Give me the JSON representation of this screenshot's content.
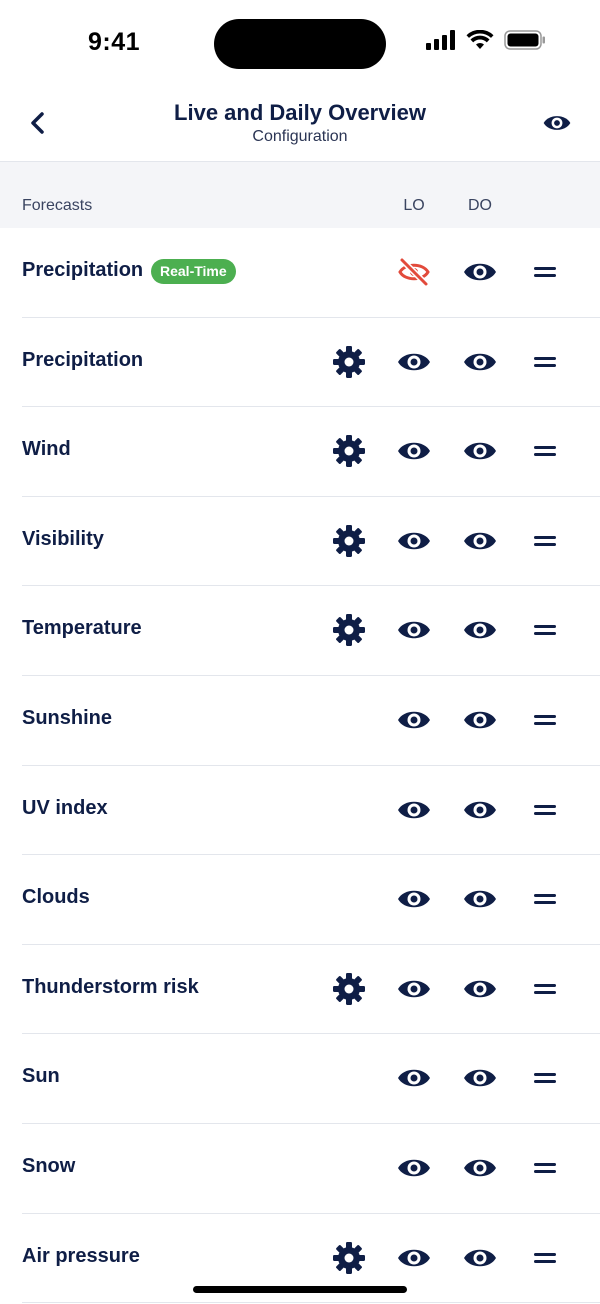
{
  "status_bar": {
    "time": "9:41"
  },
  "header": {
    "title": "Live and Daily Overview",
    "subtitle": "Configuration"
  },
  "table": {
    "section_label": "Forecasts",
    "col_lo": "LO",
    "col_do": "DO"
  },
  "colors": {
    "primary": "#0f1e46",
    "hidden": "#e24a3b",
    "badge": "#4caf50",
    "section_bg": "#f4f5f8"
  },
  "rows": [
    {
      "label": "Precipitation",
      "badge": "Real-Time",
      "settings": false,
      "lo_visible": false,
      "do_visible": true
    },
    {
      "label": "Precipitation",
      "settings": true,
      "lo_visible": true,
      "do_visible": true
    },
    {
      "label": "Wind",
      "settings": true,
      "lo_visible": true,
      "do_visible": true
    },
    {
      "label": "Visibility",
      "settings": true,
      "lo_visible": true,
      "do_visible": true
    },
    {
      "label": "Temperature",
      "settings": true,
      "lo_visible": true,
      "do_visible": true
    },
    {
      "label": "Sunshine",
      "settings": false,
      "lo_visible": true,
      "do_visible": true
    },
    {
      "label": "UV index",
      "settings": false,
      "lo_visible": true,
      "do_visible": true
    },
    {
      "label": "Clouds",
      "settings": false,
      "lo_visible": true,
      "do_visible": true
    },
    {
      "label": "Thunderstorm risk",
      "settings": true,
      "lo_visible": true,
      "do_visible": true
    },
    {
      "label": "Sun",
      "settings": false,
      "lo_visible": true,
      "do_visible": true
    },
    {
      "label": "Snow",
      "settings": false,
      "lo_visible": true,
      "do_visible": true
    },
    {
      "label": "Air pressure",
      "settings": true,
      "lo_visible": true,
      "do_visible": true
    }
  ]
}
